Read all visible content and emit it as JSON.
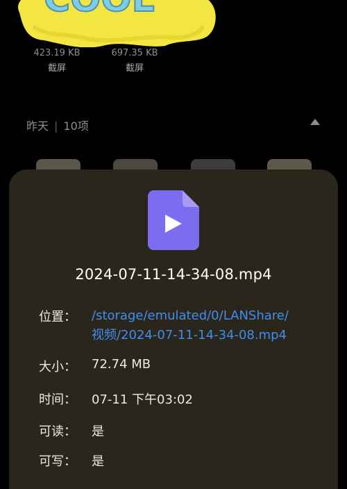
{
  "thumbnails": [
    {
      "size": "423.19 KB",
      "name": "截屏"
    },
    {
      "size": "697.35 KB",
      "name": "截屏"
    }
  ],
  "sticker": {
    "text": "COOL"
  },
  "section": {
    "date": "昨天",
    "separator": "|",
    "count": "10项"
  },
  "sheet": {
    "icon": "video-file-icon",
    "file_name": "2024-07-11-14-34-08.mp4",
    "rows": {
      "location": {
        "label": "位置：",
        "line1": "/storage/emulated/0/LANShare/",
        "line2": "视频/2024-07-11-14-34-08.mp4"
      },
      "size": {
        "label": "大小：",
        "value": "72.74 MB"
      },
      "time": {
        "label": "时间：",
        "value": "07-11 下午03:02"
      },
      "readable": {
        "label": "可读：",
        "value": "是"
      },
      "writable": {
        "label": "可写：",
        "value": "是"
      }
    }
  },
  "colors": {
    "accent_link": "#3e8ef0",
    "sheet_bg": "#2a261c",
    "file_icon": "#7b6cf0"
  }
}
